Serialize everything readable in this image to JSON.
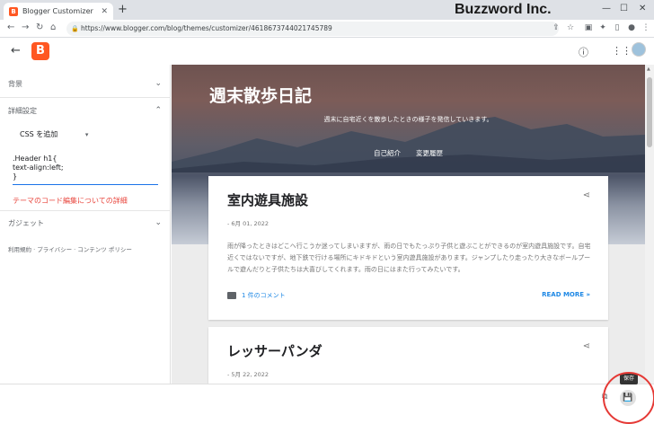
{
  "browser": {
    "tab_title": "Blogger Customizer",
    "tab_favicon": "B",
    "new_tab": "+",
    "url": "https://www.blogger.com/blog/themes/customizer/4618673744021745789",
    "brand": "Buzzword Inc."
  },
  "appbar": {
    "logo": "B"
  },
  "sidebar": {
    "background_label": "背景",
    "advanced_label": "詳細設定",
    "css_select_value": "CSS を追加",
    "css_code": [
      ".Header h1{",
      "text-align:left;",
      "}"
    ],
    "detail_link": "テーマのコード編集についての詳細",
    "gadgets_label": "ガジェット",
    "footer_links": "利用規約 · プライバシー · コンテンツ ポリシー"
  },
  "blog": {
    "title": "週末散歩日記",
    "description": "週末に自宅近くを散歩したときの様子を発信していきます。",
    "nav": [
      "自己紹介",
      "変更履歴"
    ]
  },
  "posts": [
    {
      "title": "室内遊具施設",
      "date": "- 6月 01, 2022",
      "body": "雨が降ったときはどこへ行こうか迷ってしまいますが、雨の日でもたっぷり子供と遊ぶことができるのが室内遊具施設です。自宅近くではないですが、地下鉄で行ける場所にキドキドという室内遊具施設があります。ジャンプしたり走ったり大きなボールプールで遊んだりと子供たちは大喜びしてくれます。雨の日にはまた行ってみたいです。",
      "comments": "1 件のコメント",
      "read_more": "READ MORE »"
    },
    {
      "title": "レッサーパンダ",
      "date": "- 5月 22, 2022"
    }
  ],
  "bottom": {
    "save_tooltip": "保存"
  }
}
